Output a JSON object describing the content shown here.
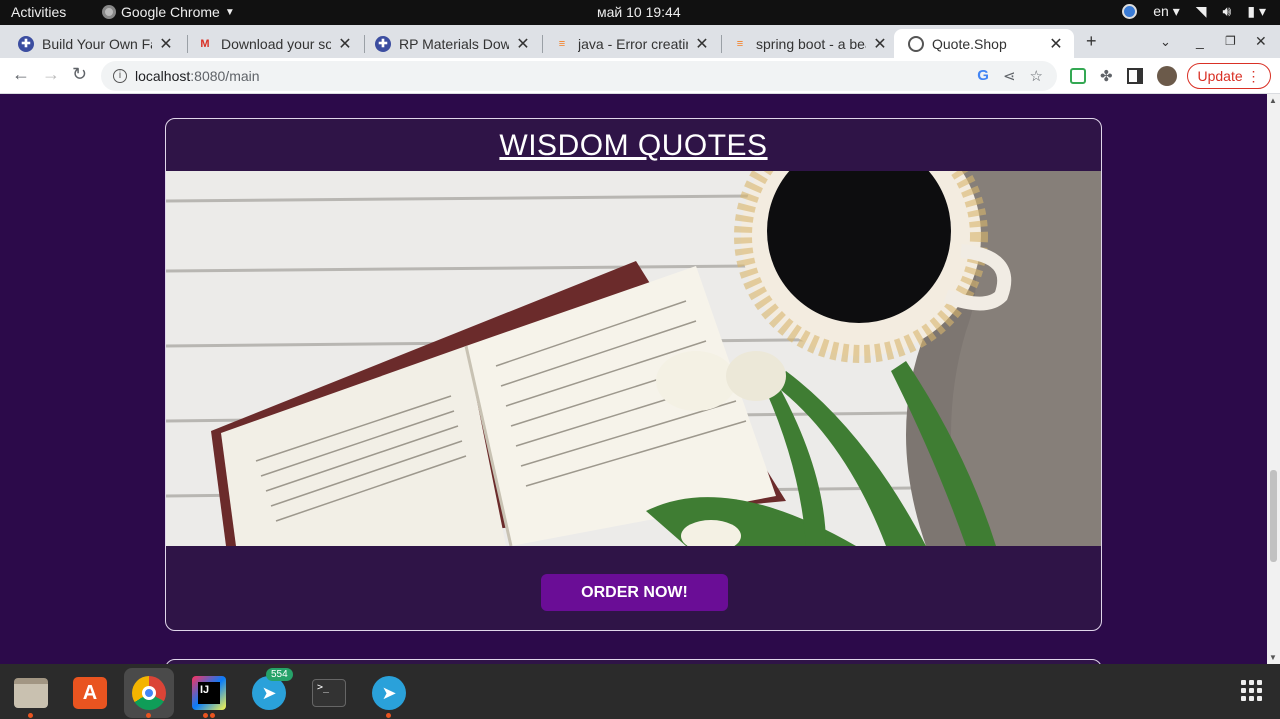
{
  "system_bar": {
    "activities": "Activities",
    "app_name": "Google Chrome",
    "clock": "май 10  19:44",
    "keyboard_layout": "en"
  },
  "tabs": [
    {
      "title": "Build Your Own Fa",
      "icon": "globe-icon"
    },
    {
      "title": "Download your so",
      "icon": "gmail-icon"
    },
    {
      "title": "RP Materials Dow",
      "icon": "globe-icon"
    },
    {
      "title": "java - Error creatin",
      "icon": "stackoverflow-icon"
    },
    {
      "title": "spring boot - a bea",
      "icon": "stackoverflow-icon"
    },
    {
      "title": "Quote.Shop",
      "icon": "globe-icon",
      "active": true
    }
  ],
  "address_bar": {
    "host": "localhost",
    "path": ":8080/main"
  },
  "update_button": "Update",
  "page": {
    "card_title": "WISDOM QUOTES",
    "order_button": "ORDER NOW!",
    "colors": {
      "background": "#2c0a4a",
      "card": "#2f1447",
      "button": "#6a0d96"
    }
  },
  "dock": {
    "telegram_badge": "554",
    "items": [
      "files-icon",
      "app-store-icon",
      "chrome-icon",
      "intellij-icon",
      "telegram-icon",
      "terminal-icon",
      "telegram-desktop-icon",
      "show-apps-icon"
    ]
  }
}
